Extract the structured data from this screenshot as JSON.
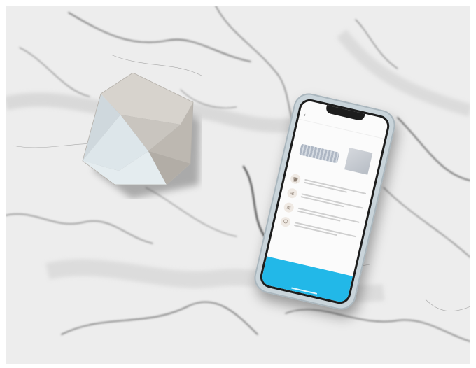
{
  "scene": {
    "subject": "marble-tabletop-product-shot",
    "colors": {
      "marble_base": "#ececec",
      "marble_vein": "#5a5a5a",
      "app_accent": "#22b8e8",
      "device_body": "#d9d6d1"
    }
  },
  "phone": {
    "status_time": "",
    "status_icons": "",
    "header_title": "",
    "back_icon": "chevron-left-icon",
    "headline": "",
    "intro": "",
    "steps": [
      {
        "icon": "hub-icon"
      },
      {
        "icon": "wifi-icon"
      },
      {
        "icon": "wifi-icon"
      },
      {
        "icon": "plug-icon"
      }
    ],
    "footer_button_label": ""
  }
}
